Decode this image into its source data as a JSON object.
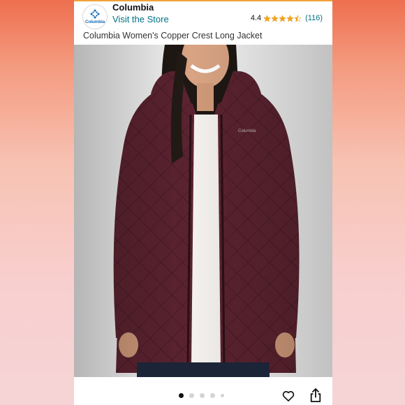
{
  "brand": {
    "name": "Columbia",
    "logo_text": "Columbia",
    "store_link": "Visit the Store"
  },
  "rating": {
    "value": "4.4",
    "stars": 4.4,
    "count": "(116)",
    "star_color": "#f4a41c"
  },
  "product": {
    "title": "Columbia Women's Copper Crest Long Jacket",
    "image_alt": "woman-wearing-burgundy-quilted-long-jacket",
    "jacket_color": "#5b2330"
  },
  "gallery": {
    "total_images": 5,
    "active_index": 0
  },
  "actions": {
    "favorite_icon": "heart-icon",
    "share_icon": "share-icon"
  },
  "colors": {
    "link": "#007185",
    "accent_top": "#f0a23b"
  }
}
